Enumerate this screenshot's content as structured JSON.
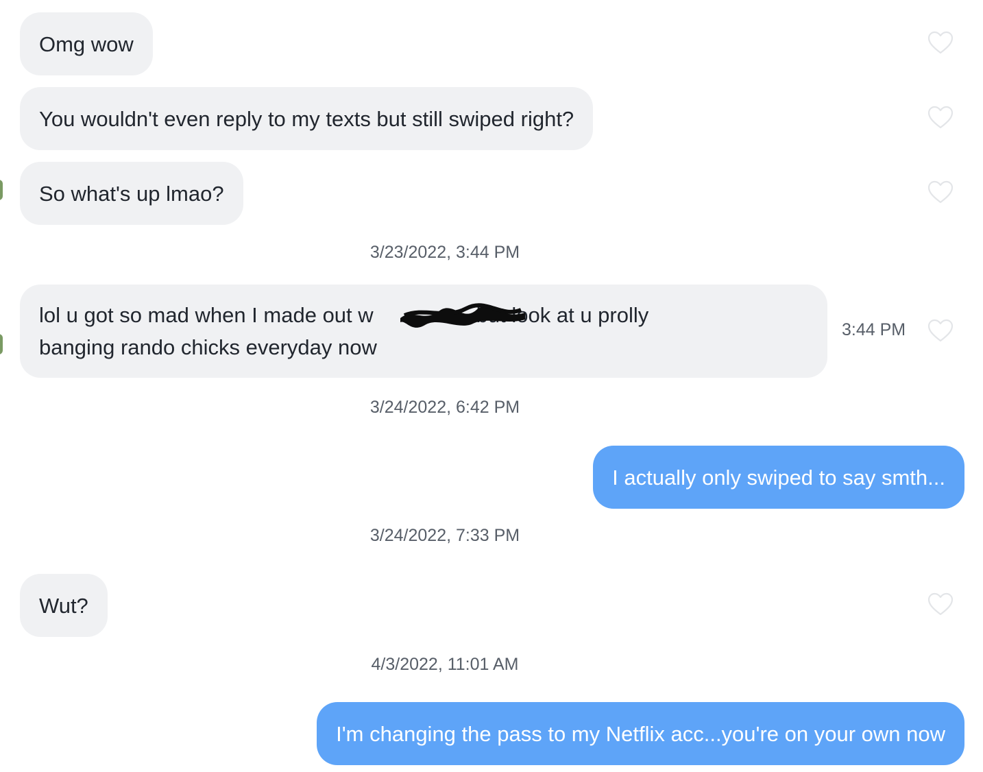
{
  "messages": [
    {
      "from": "them",
      "text": "Omg wow",
      "heart": "heart-outline-icon"
    },
    {
      "from": "them",
      "text": "You wouldn't even reply to my texts but still swiped right?",
      "heart": "heart-outline-icon"
    },
    {
      "from": "them",
      "text": "So what's up lmao?",
      "heart": "heart-outline-icon"
    },
    {
      "type": "date",
      "text": "3/23/2022, 3:44 PM"
    },
    {
      "from": "them",
      "text": "lol u got so mad when I made out w",
      "text_after": "but look at u prolly",
      "text_line2": "banging rando chicks everyday now",
      "time": "3:44 PM",
      "heart": "heart-outline-icon",
      "note_redacted": "redaction-scribble"
    },
    {
      "type": "date",
      "text": "3/24/2022, 6:42 PM"
    },
    {
      "from": "me",
      "text": "I actually only swiped to say smth..."
    },
    {
      "type": "date",
      "text": "3/24/2022, 7:33 PM"
    },
    {
      "from": "them",
      "text": "Wut?",
      "heart": "heart-outline-icon"
    },
    {
      "type": "date",
      "text": "4/3/2022, 11:01 AM"
    },
    {
      "from": "me",
      "text": "I'm changing the pass to my Netflix acc...you're on your own now"
    }
  ],
  "colors": {
    "incoming_bg": "#f0f1f3",
    "outgoing_bg": "#5ea4f8",
    "meta_text": "#575e68",
    "heart_stroke": "#e3e5e8"
  }
}
